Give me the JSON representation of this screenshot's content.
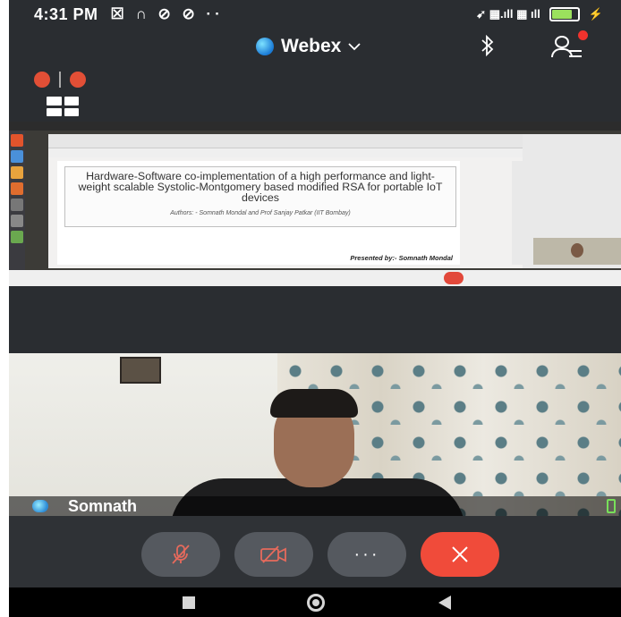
{
  "status_bar": {
    "time": "4:31 PM",
    "notification_icons": "☒ ∩ ⊘ ⊘ ··",
    "right_icons": "➹ ▦.ıll ▦ ıll",
    "battery_level_percent": 80,
    "battery_color": "#9be15d"
  },
  "header": {
    "app_name": "Webex",
    "dropdown_icon": "chevron-down-icon",
    "bluetooth_icon": "bluetooth-icon",
    "participants_icon": "participants-icon",
    "notification_dot_color": "#f0322d"
  },
  "toolbar": {
    "layout_icon": "grid-layout-icon"
  },
  "shared_content": {
    "slide_title": "Hardware-Software co-implementation of a high performance and light-weight scalable Systolic-Montgomery based modified RSA for portable IoT devices",
    "slide_authors": "Authors: - Somnath Mondal and Prof Sanjay Patkar (IIT Bombay)",
    "slide_footer": "Presented by:- Somnath Mondal"
  },
  "video": {
    "participant_name": "Somnath"
  },
  "controls": {
    "mute_icon": "mic-muted-icon",
    "video_icon": "video-off-icon",
    "more_label": "···",
    "end_icon": "close-icon",
    "end_color": "#f04b3a"
  },
  "navigation": {
    "recents_icon": "square-icon",
    "home_icon": "circle-icon",
    "back_icon": "triangle-back-icon"
  }
}
